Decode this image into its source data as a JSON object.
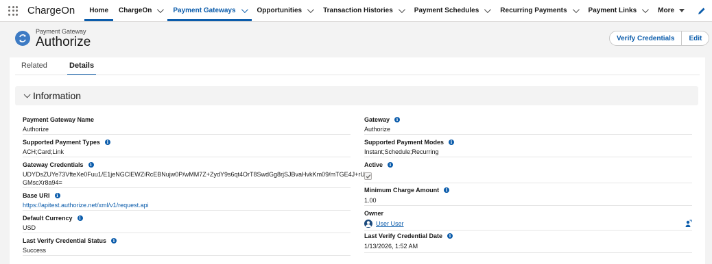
{
  "app_name": "ChargeOn",
  "nav_tabs": [
    {
      "label": "Home"
    },
    {
      "label": "ChargeOn"
    },
    {
      "label": "Payment Gateways"
    },
    {
      "label": "Opportunities"
    },
    {
      "label": "Transaction Histories"
    },
    {
      "label": "Payment Schedules"
    },
    {
      "label": "Recurring Payments"
    },
    {
      "label": "Payment Links"
    },
    {
      "label": "More"
    }
  ],
  "record": {
    "type_label": "Payment Gateway",
    "title": "Authorize"
  },
  "actions": {
    "verify_label": "Verify Credentials",
    "edit_label": "Edit"
  },
  "subtabs": [
    {
      "label": "Related"
    },
    {
      "label": "Details"
    }
  ],
  "section": {
    "title": "Information"
  },
  "fields_left": [
    {
      "label": "Payment Gateway Name",
      "value": "Authorize"
    },
    {
      "label": "Supported Payment Types",
      "value": "ACH;Card;Link"
    },
    {
      "label": "Gateway Credentials",
      "value_line1": "UDYDsZUYe73VfteXe0Fuu1/E1jeNGClEWZiRcEBNujw0P/wMM7Z+ZydY9s6qt4OrT8SwdGg8rjSJBvaHvkKm09/mTGE4J+rUs",
      "value_line2": "GMscXr8a94="
    },
    {
      "label": "Base URI",
      "value": "https://apitest.authorize.net/xml/v1/request.api"
    },
    {
      "label": "Default Currency",
      "value": "USD"
    },
    {
      "label": "Last Verify Credential Status",
      "value": "Success"
    }
  ],
  "fields_right": [
    {
      "label": "Gateway",
      "value": "Authorize"
    },
    {
      "label": "Supported Payment Modes",
      "value": "Instant;Schedule;Recurring"
    },
    {
      "label": "Active",
      "checked": true
    },
    {
      "label": "Minimum Charge Amount",
      "value": "1.00"
    },
    {
      "label": "Owner",
      "value": "User User"
    },
    {
      "label": "Last Verify Credential Date",
      "value": "1/13/2026, 1:52 AM"
    }
  ],
  "colors": {
    "brand_blue": "#0b5cab",
    "record_icon": "#3d7bc4"
  },
  "icons": [
    "waffle-icon",
    "chevron-down-icon",
    "caret-down-icon",
    "pencil-icon",
    "payment-gateway-icon",
    "info-icon",
    "checkbox-icon",
    "avatar-icon",
    "change-owner-icon"
  ]
}
